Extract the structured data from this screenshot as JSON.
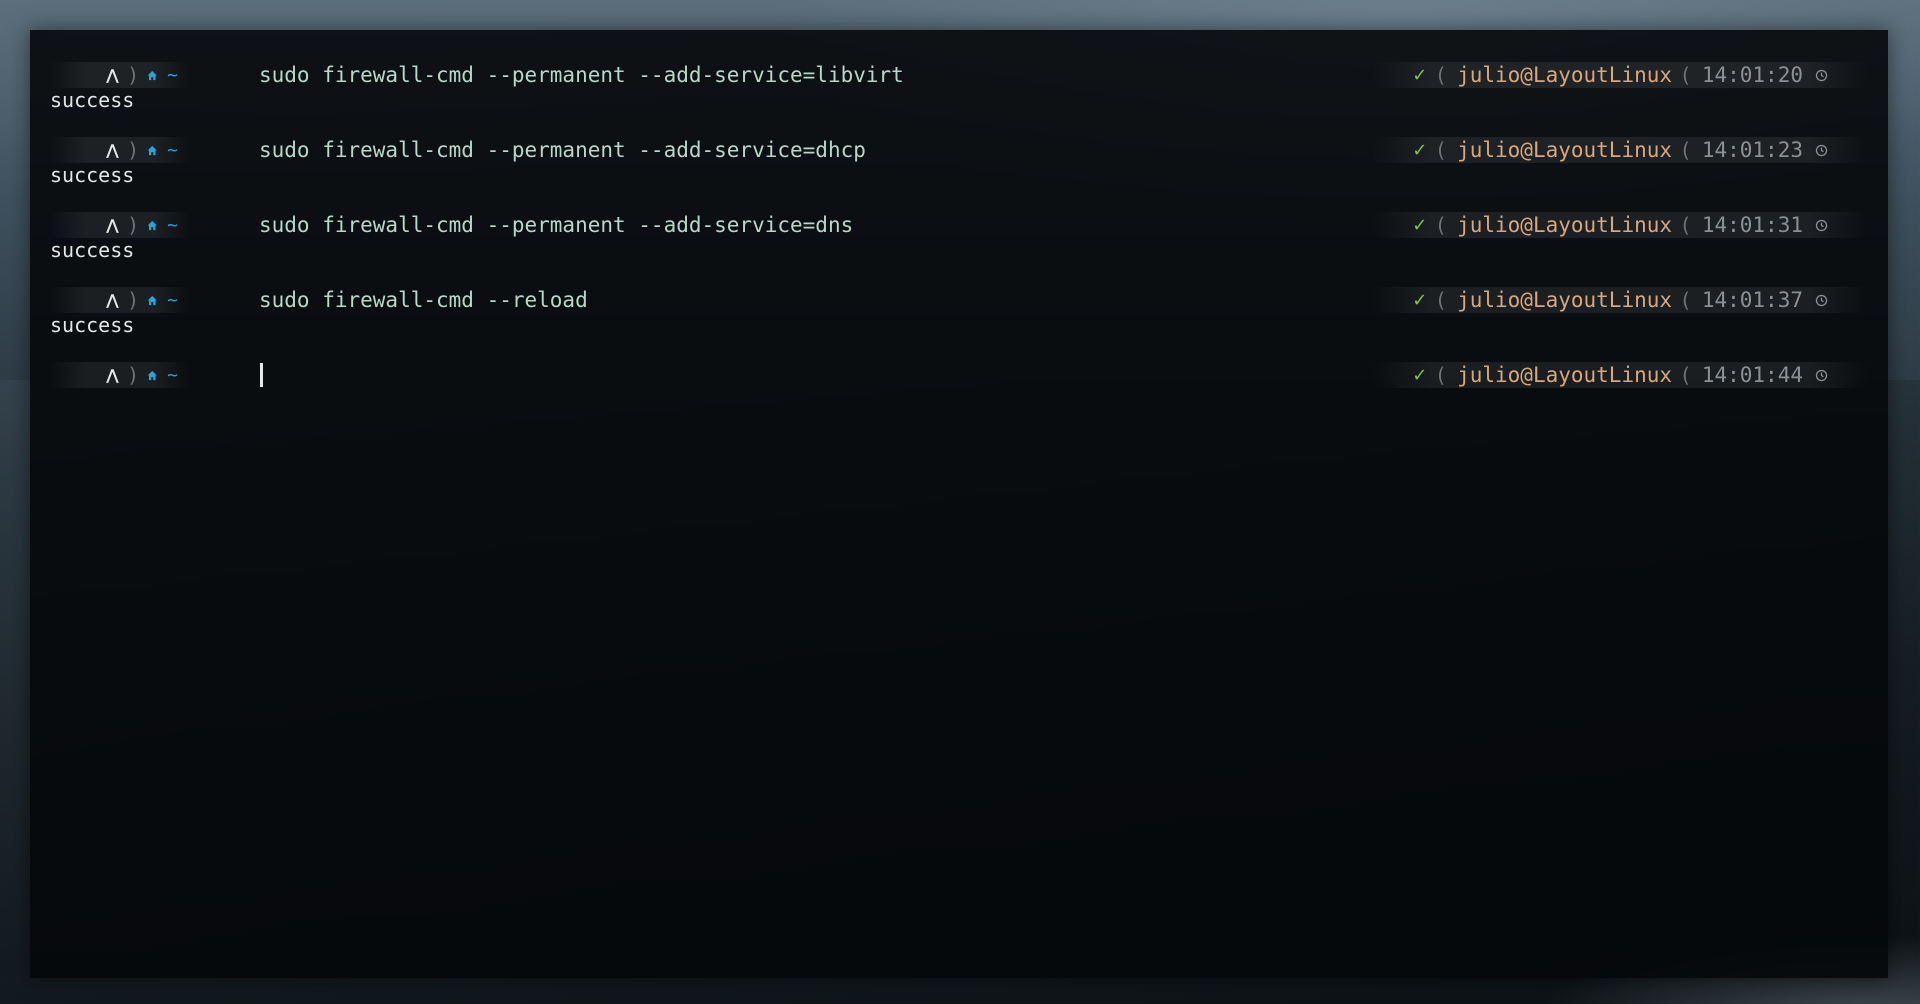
{
  "prompt": {
    "os_icon": "arch-linux-icon",
    "separator": ")",
    "home_icon": "home-icon",
    "dir": "~",
    "status_icon": "✓",
    "right_separator": "(",
    "clock_icon": "clock-icon"
  },
  "entries": [
    {
      "command": "sudo firewall-cmd --permanent --add-service=libvirt",
      "user": "julio@LayoutLinux",
      "time": "14:01:20",
      "output": "success"
    },
    {
      "command": "sudo firewall-cmd --permanent --add-service=dhcp",
      "user": "julio@LayoutLinux",
      "time": "14:01:23",
      "output": "success"
    },
    {
      "command": "sudo firewall-cmd --permanent --add-service=dns",
      "user": "julio@LayoutLinux",
      "time": "14:01:31",
      "output": "success"
    },
    {
      "command": "sudo firewall-cmd --reload",
      "user": "julio@LayoutLinux",
      "time": "14:01:37",
      "output": "success"
    }
  ],
  "current": {
    "command": "",
    "user": "julio@LayoutLinux",
    "time": "14:01:44"
  },
  "colors": {
    "command": "#b9d7c7",
    "user": "#d6a87e",
    "time": "#8b9094",
    "check": "#7ec34a",
    "dir": "#2aa3d8",
    "output": "#e5e5e5"
  }
}
